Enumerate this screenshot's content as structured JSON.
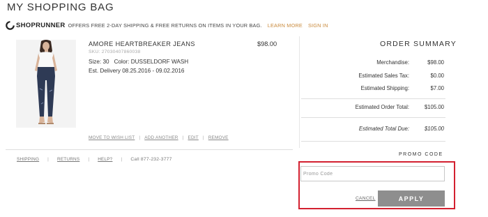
{
  "page": {
    "title": "MY SHOPPING BAG"
  },
  "shoprunner": {
    "logo_text": "SHOPRUNNER",
    "promo_text": "OFFERS FREE 2-DAY SHIPPING & FREE RETURNS ON ITEMS IN YOUR BAG.",
    "learn_more": "LEARN MORE",
    "sign_in": "SIGN IN",
    "accent_color": "#c98a3c"
  },
  "item": {
    "name": "AMORE HEARTBREAKER JEANS",
    "sku": "SKU: 27030407860038",
    "size": "Size: 30",
    "color": "Color: DUSSELDORF WASH",
    "delivery": "Est. Delivery 08.25.2016 - 09.02.2016",
    "price": "$98.00",
    "actions": [
      "MOVE TO WISH LIST",
      "ADD ANOTHER",
      "EDIT",
      "REMOVE"
    ]
  },
  "footer": {
    "links": [
      "SHIPPING",
      "RETURNS",
      "HELP?"
    ],
    "call": "Call 877-232-3777"
  },
  "summary": {
    "title": "ORDER SUMMARY",
    "rows": [
      {
        "label": "Merchandise:",
        "value": "$98.00"
      },
      {
        "label": "Estimated Sales Tax:",
        "value": "$0.00"
      },
      {
        "label": "Estimated Shipping:",
        "value": "$7.00"
      },
      {
        "label": "Estimated Order Total:",
        "value": "$105.00"
      },
      {
        "label": "Estimated Total Due:",
        "value": "$105.00"
      }
    ]
  },
  "promo": {
    "title": "PROMO CODE",
    "placeholder": "Promo Code",
    "cancel": "CANCEL",
    "apply": "APPLY",
    "highlight_color": "#d32030",
    "button_color": "#8e8e8e"
  }
}
